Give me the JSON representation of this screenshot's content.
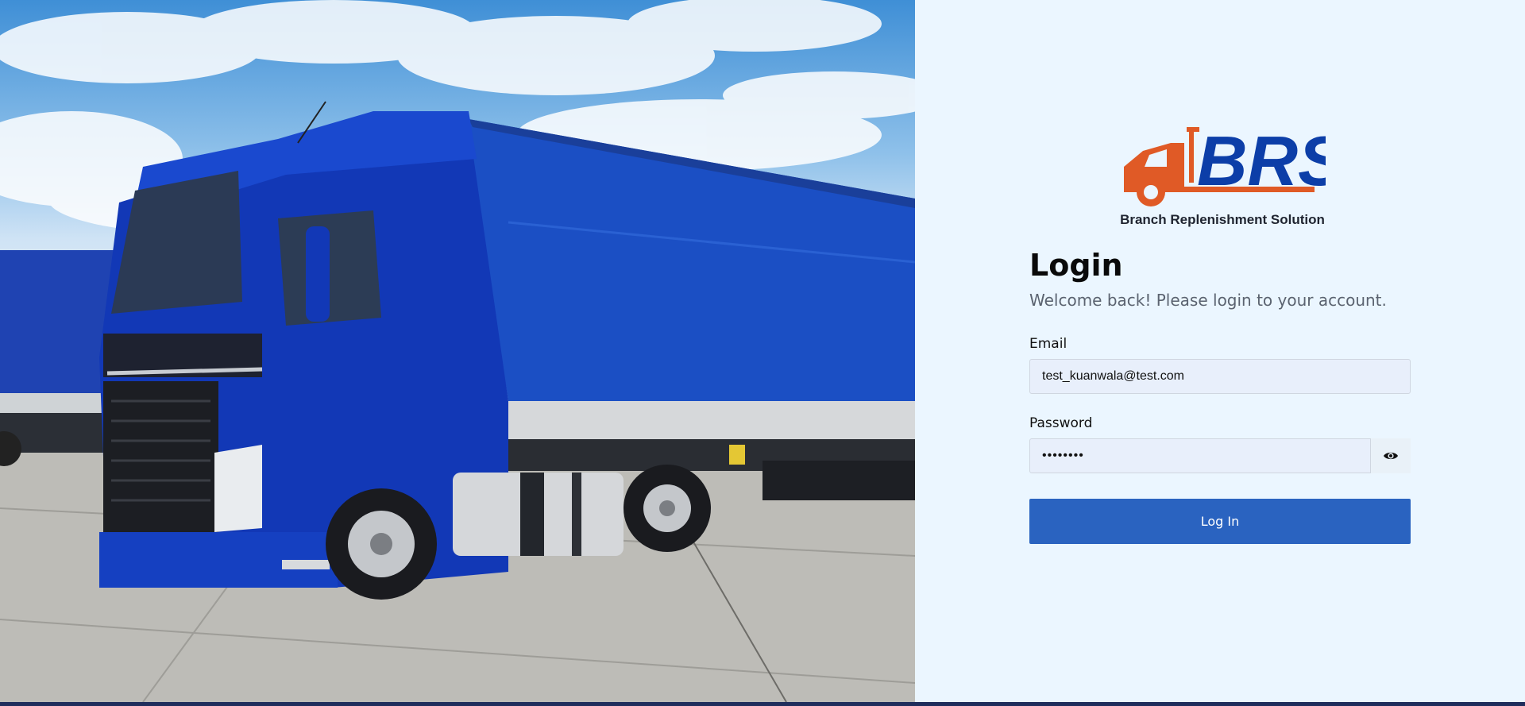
{
  "brand": {
    "logo_text": "BRS",
    "tagline": "Branch Replenishment Solution",
    "colors": {
      "primary": "#0c3ea8",
      "accent": "#e05a26"
    }
  },
  "login": {
    "title": "Login",
    "subtitle": "Welcome back! Please login to your account.",
    "email_label": "Email",
    "email_value": "test_kuanwala@test.com",
    "password_label": "Password",
    "password_value": "••••••••",
    "show_password_icon": "eye-icon",
    "submit_label": "Log In",
    "button_color": "#2a63c0"
  }
}
